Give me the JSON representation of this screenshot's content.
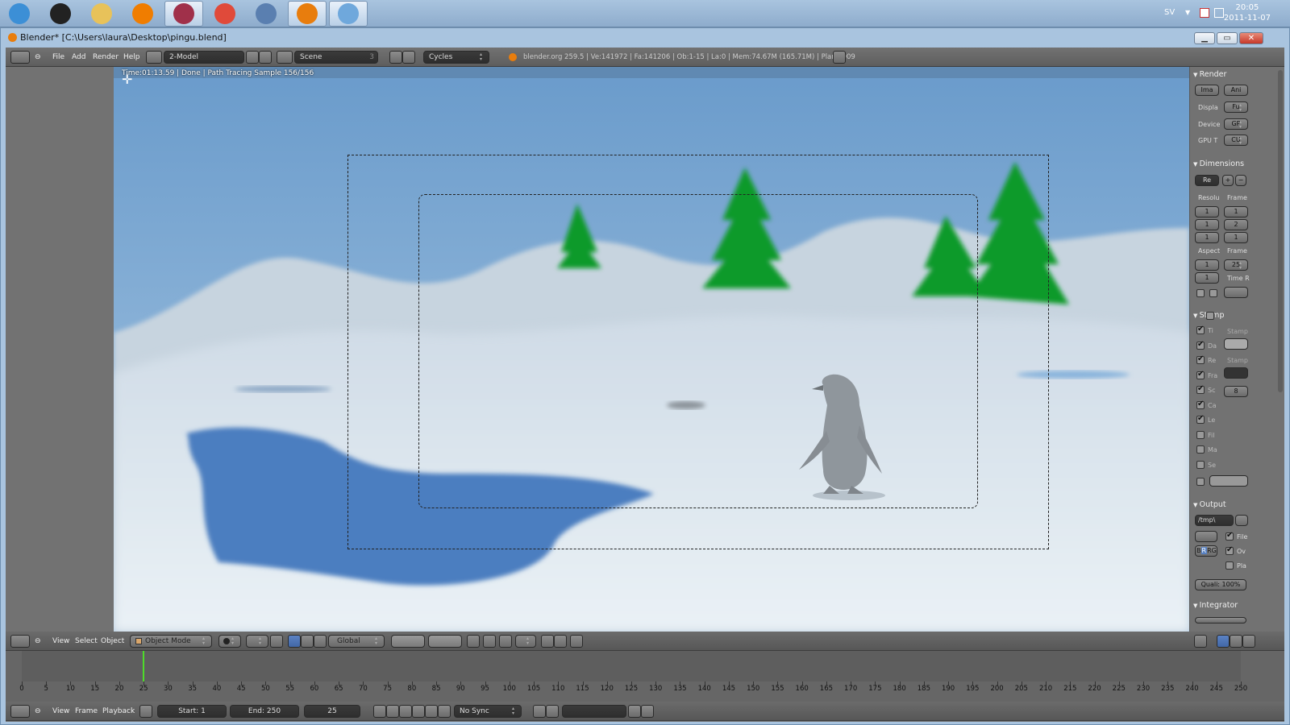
{
  "taskbar": {
    "apps": [
      {
        "name": "windows-start-icon",
        "color": "#3c8fd6"
      },
      {
        "name": "steam-icon",
        "color": "#222222"
      },
      {
        "name": "file-explorer-icon",
        "color": "#e8c25a"
      },
      {
        "name": "vlc-icon",
        "color": "#f07d00"
      },
      {
        "name": "winrar-icon",
        "color": "#a0304a"
      },
      {
        "name": "chrome-icon",
        "color": "#e04a3a"
      },
      {
        "name": "image-viewer-icon",
        "color": "#5a7fb0"
      },
      {
        "name": "blender-icon",
        "color": "#e87d0d"
      },
      {
        "name": "paint-icon",
        "color": "#6fa8dc"
      }
    ],
    "language": "SV",
    "clock_time": "20:05",
    "clock_date": "2011-11-07"
  },
  "window": {
    "title": "Blender* [C:\\Users\\laura\\Desktop\\pingu.blend]"
  },
  "info_header": {
    "menus": [
      "File",
      "Add",
      "Render",
      "Help"
    ],
    "screen_layout": "2-Model",
    "scene": "Scene",
    "scene_users": "3",
    "render_engine": "Cycles",
    "stats": "blender.org 259.5 | Ve:141972 | Fa:141206 | Ob:1-15 | La:0 | Mem:74.67M (165.71M) | Plane.009"
  },
  "viewport": {
    "render_info": "Time:01:13.59 | Done | Path Tracing Sample 156/156"
  },
  "properties": {
    "render": {
      "title": "Render",
      "image_btn": "Ima",
      "anim_btn": "Ani",
      "display_label": "Displa",
      "display_value": "Fu",
      "device_label": "Device",
      "device_value": "GP",
      "gpu_label": "GPU T",
      "gpu_value": "CU"
    },
    "dimensions": {
      "title": "Dimensions",
      "preset": "Re",
      "resolution_label": "Resolu",
      "frame_label": "Frame",
      "res_x": "1",
      "res_y": "1",
      "res_pct": "1",
      "frame_start": "1",
      "frame_end": "2",
      "frame_step": "1",
      "aspect_label": "Aspect",
      "framerate_label": "Frame",
      "aspect_x": "1",
      "aspect_y": "1",
      "fps": "25",
      "time_remap_label": "Time R"
    },
    "stamp": {
      "title": "Stamp",
      "items": [
        "Ti",
        "Da",
        "Re",
        "Fra",
        "Sc",
        "Ca",
        "Le",
        "Fil",
        "Ma",
        "Se"
      ],
      "stamp_label_1": "Stamp",
      "stamp_label_2": "Stamp",
      "font_size": "8"
    },
    "output": {
      "title": "Output",
      "path": "/tmp\\",
      "file_ext_label": "File",
      "overwrite_label": "Ov",
      "placeholders_label": "Pla",
      "color_bw": "B",
      "color_rgb": "RG",
      "color_r": "R",
      "quality": "Quali: 100%"
    },
    "integrator": {
      "title": "Integrator"
    }
  },
  "view3d_header": {
    "menus": [
      "View",
      "Select",
      "Object"
    ],
    "mode": "Object Mode",
    "orientation": "Global"
  },
  "timeline": {
    "ticks": [
      "0",
      "5",
      "10",
      "15",
      "20",
      "25",
      "30",
      "35",
      "40",
      "45",
      "50",
      "55",
      "60",
      "65",
      "70",
      "75",
      "80",
      "85",
      "90",
      "95",
      "100",
      "105",
      "110",
      "115",
      "120",
      "125",
      "130",
      "135",
      "140",
      "145",
      "150",
      "155",
      "160",
      "165",
      "170",
      "175",
      "180",
      "185",
      "190",
      "195",
      "200",
      "205",
      "210",
      "215",
      "220",
      "225",
      "230",
      "235",
      "240",
      "245",
      "250"
    ],
    "current_frame_value": 25,
    "menus": [
      "View",
      "Frame",
      "Playback"
    ],
    "start": "Start: 1",
    "end": "End: 250",
    "current": "25",
    "sync": "No Sync"
  }
}
